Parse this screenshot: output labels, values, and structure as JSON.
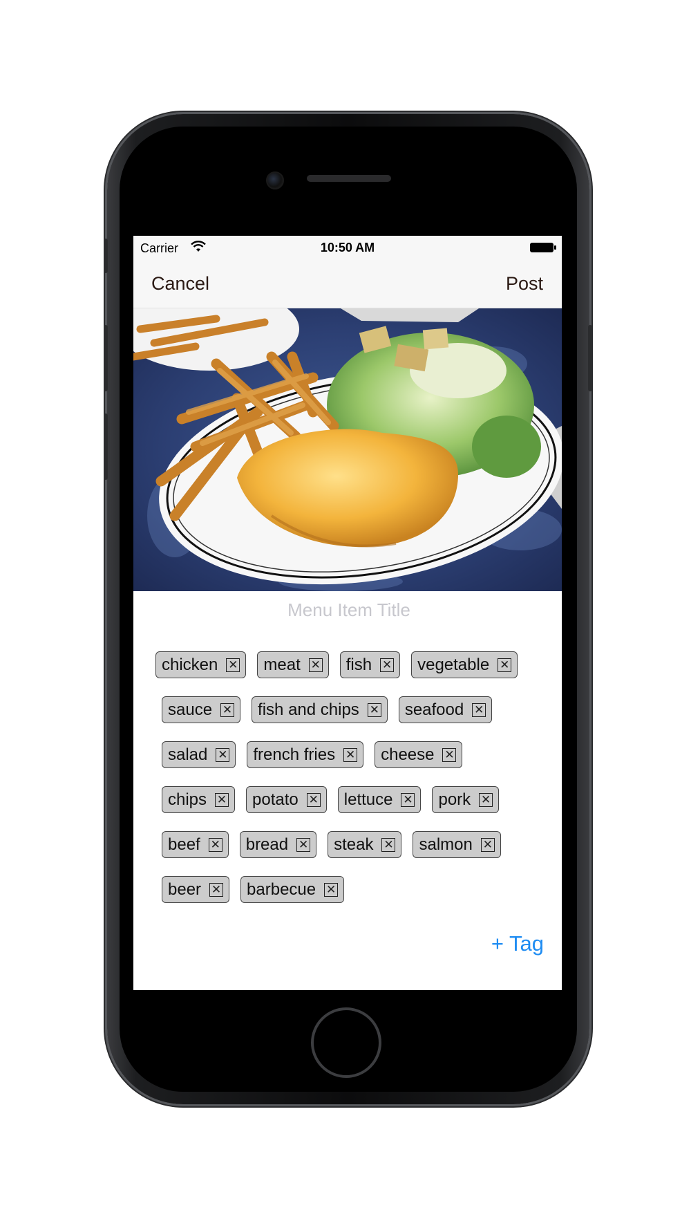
{
  "status_bar": {
    "carrier": "Carrier",
    "time": "10:50 AM"
  },
  "nav": {
    "cancel_label": "Cancel",
    "post_label": "Post"
  },
  "photo": {
    "alt": "Fish and chips with Caesar salad"
  },
  "title_field": {
    "placeholder": "Menu Item Title",
    "value": ""
  },
  "tags": [
    [
      "chicken",
      "meat",
      "fish",
      "vegetable"
    ],
    [
      "sauce",
      "fish and chips",
      "seafood"
    ],
    [
      "salad",
      "french fries",
      "cheese"
    ],
    [
      "chips",
      "potato",
      "lettuce",
      "pork"
    ],
    [
      "beef",
      "bread",
      "steak",
      "salmon"
    ],
    [
      "beer",
      "barbecue"
    ]
  ],
  "tag_remove_glyph": "☒",
  "add_tag_label": "+ Tag",
  "colors": {
    "accent": "#1e8cf2",
    "tag_bg": "#cccccc",
    "nav_text": "#2b1a14"
  }
}
